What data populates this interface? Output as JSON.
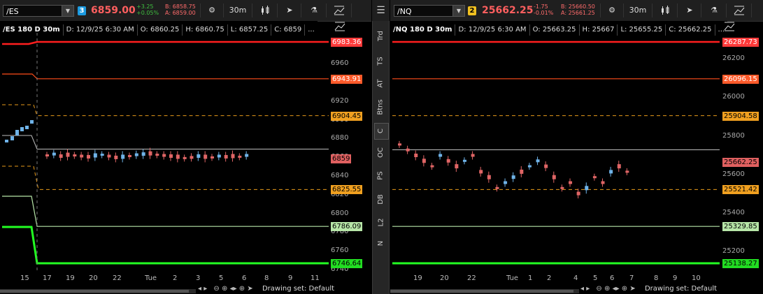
{
  "colors": {
    "up": "#6fb3e8",
    "down": "#e06565",
    "red_line": "#ff1e1e",
    "orange_line": "#ff4d1a",
    "dash": "#e89a1a",
    "green_thick": "#22ff22",
    "green_thin": "#b7e6a8",
    "gray_line": "#bdbdbd",
    "link1": "#1b9ae0",
    "link2": "#f0c020"
  },
  "panels": [
    {
      "id": "es",
      "symbol": "/ES",
      "link_num": "3",
      "last": "6859.00",
      "chg": "+3.25",
      "chg_pct": "+0.05%",
      "bid": "B: 6858.75",
      "ask": "A: 6859.00",
      "timeframe": "30m",
      "info": {
        "title": "/ES 180 D 30m",
        "date": "D: 12/9/25 6:30 AM",
        "open": "O: 6860.25",
        "high": "H: 6860.75",
        "low": "L: 6857.25",
        "close": "C: 6859",
        "more": "..."
      },
      "yticks": [
        "6960",
        "6940",
        "6920",
        "6900",
        "6880",
        "6860",
        "6840",
        "6820",
        "6800",
        "6780",
        "6760",
        "6740"
      ],
      "price_labels": [
        {
          "text": "6983.36",
          "value": 6983.36,
          "bg": "#ff3a3a",
          "fg": "#fff"
        },
        {
          "text": "6943.91",
          "value": 6943.91,
          "bg": "#ff5a2a",
          "fg": "#fff"
        },
        {
          "text": "6904.45",
          "value": 6904.45,
          "bg": "#f0a020",
          "fg": "#000"
        },
        {
          "text": "6859",
          "value": 6859,
          "bg": "#e06060",
          "fg": "#000"
        },
        {
          "text": "6825.55",
          "value": 6825.55,
          "bg": "#f0a020",
          "fg": "#000"
        },
        {
          "text": "6786.09",
          "value": 6786.09,
          "bg": "#b7e6a8",
          "fg": "#000"
        },
        {
          "text": "6746.64",
          "value": 6746.64,
          "bg": "#22dd22",
          "fg": "#000"
        }
      ],
      "xticks": [
        "15",
        "17",
        "19",
        "20",
        "22",
        "Tue",
        "2",
        "3",
        "5",
        "6",
        "8",
        "9",
        "11"
      ],
      "drawing_set": "Drawing set: Default"
    },
    {
      "id": "nq",
      "symbol": "/NQ",
      "link_num": "2",
      "last": "25662.25",
      "chg": "-1.75",
      "chg_pct": "-0.01%",
      "bid": "B: 25660.50",
      "ask": "A: 25661.25",
      "timeframe": "30m",
      "info": {
        "title": "/NQ 180 D 30m",
        "date": "D: 12/9/25 6:30 AM",
        "open": "O: 25663.25",
        "high": "H: 25667",
        "low": "L: 25655.25",
        "close": "C: 25662.25",
        "more": "..."
      },
      "yticks": [
        "26200",
        "26000",
        "25800",
        "25600",
        "25400",
        "25200"
      ],
      "price_labels": [
        {
          "text": "26287.73",
          "value": 26287.73,
          "bg": "#ff3a3a",
          "fg": "#fff"
        },
        {
          "text": "26096.15",
          "value": 26096.15,
          "bg": "#ff5a2a",
          "fg": "#fff"
        },
        {
          "text": "25904.58",
          "value": 25904.58,
          "bg": "#f0a020",
          "fg": "#000"
        },
        {
          "text": "25662.25",
          "value": 25662.25,
          "bg": "#e06060",
          "fg": "#000"
        },
        {
          "text": "25521.42",
          "value": 25521.42,
          "bg": "#f0a020",
          "fg": "#000"
        },
        {
          "text": "25329.85",
          "value": 25329.85,
          "bg": "#b7e6a8",
          "fg": "#000"
        },
        {
          "text": "25138.27",
          "value": 25138.27,
          "bg": "#22dd22",
          "fg": "#000"
        }
      ],
      "xticks": [
        "19",
        "20",
        "22",
        "Tue",
        "1",
        "2",
        "4",
        "5",
        "6",
        "7",
        "8",
        "9",
        "10"
      ],
      "drawing_set": "Drawing set: Default"
    }
  ],
  "sidebar": [
    "Trd",
    "TS",
    "AT",
    "Btns",
    "C",
    "OC",
    "PS",
    "DB",
    "L2",
    "N"
  ],
  "sidebar_selected": "C",
  "toolbar_icons": [
    "gear-icon",
    "candles-icon",
    "cursor-icon",
    "flask-icon",
    "drawing-icon"
  ],
  "bottom_icons": [
    "zoom-out-icon",
    "zoom-in-icon",
    "pan-icon",
    "crosshair-icon",
    "cursor-icon"
  ]
}
